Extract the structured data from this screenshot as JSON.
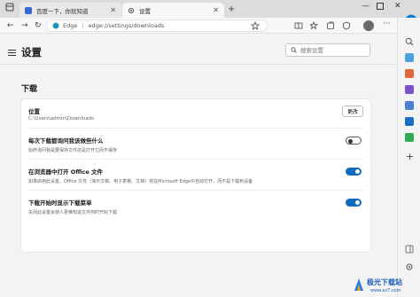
{
  "tabs": [
    {
      "title": "百度一下，你就知道",
      "active": false
    },
    {
      "title": "设置",
      "active": true
    }
  ],
  "address": {
    "site_label": "Edge",
    "url": "edge://settings/downloads"
  },
  "settings": {
    "title": "设置",
    "search_placeholder": "搜索设置",
    "section_title": "下载",
    "location": {
      "title": "位置",
      "path": "C:\\Users\\admin\\Downloads",
      "change_label": "更改"
    },
    "rows": [
      {
        "title": "每次下载都询问我该做些什么",
        "desc": "始终询问我是要保存文件还是打开它而不保存",
        "enabled": false
      },
      {
        "title": "在浏览器中打开 Office 文件",
        "desc": "如果启用此设置，Office 文件（演示文稿、电子表格、文档）将在Microsoft Edge中自动打开，而不是下载到设备",
        "enabled": true
      },
      {
        "title": "下载开始时显示下载菜单",
        "desc": "关闭此设置会使人更难知道文件何时开始下载",
        "enabled": true
      }
    ]
  },
  "watermark": {
    "text": "极光下载站",
    "sub": "www.xz7.com"
  },
  "colors": {
    "accent": "#0f6cbd",
    "page_bg": "#f3f3f3",
    "card_bg": "#ffffff"
  }
}
